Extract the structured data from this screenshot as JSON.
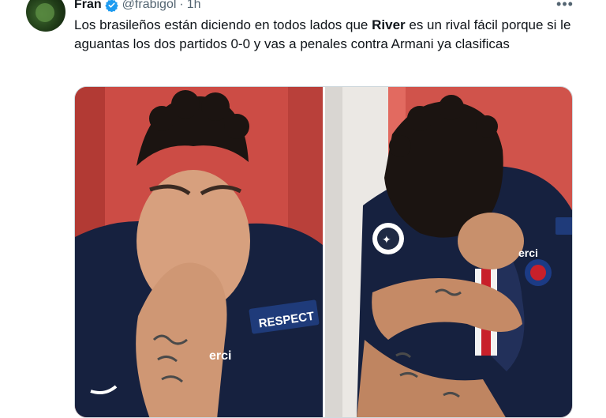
{
  "tweet": {
    "author_name": "Fran",
    "handle": "@frabigol",
    "separator": "·",
    "time": "1h",
    "more_label": "•••",
    "text_before": "Los brasileños están diciendo en todos lados que ",
    "text_bold": "River",
    "text_after": " es un rival fácil porque si le aguantas los dos partidos 0-0 y vas a penales contra Armani ya clasificas"
  },
  "photos": {
    "left": {
      "badge_text": "RESPECT",
      "shirt_text": "erci"
    },
    "right": {
      "shirt_text": "erci"
    }
  },
  "colors": {
    "verified": "#1d9bf0",
    "seat_red": "#d0534b",
    "jersey_navy": "#16213f",
    "jersey_red": "#c8202a"
  }
}
